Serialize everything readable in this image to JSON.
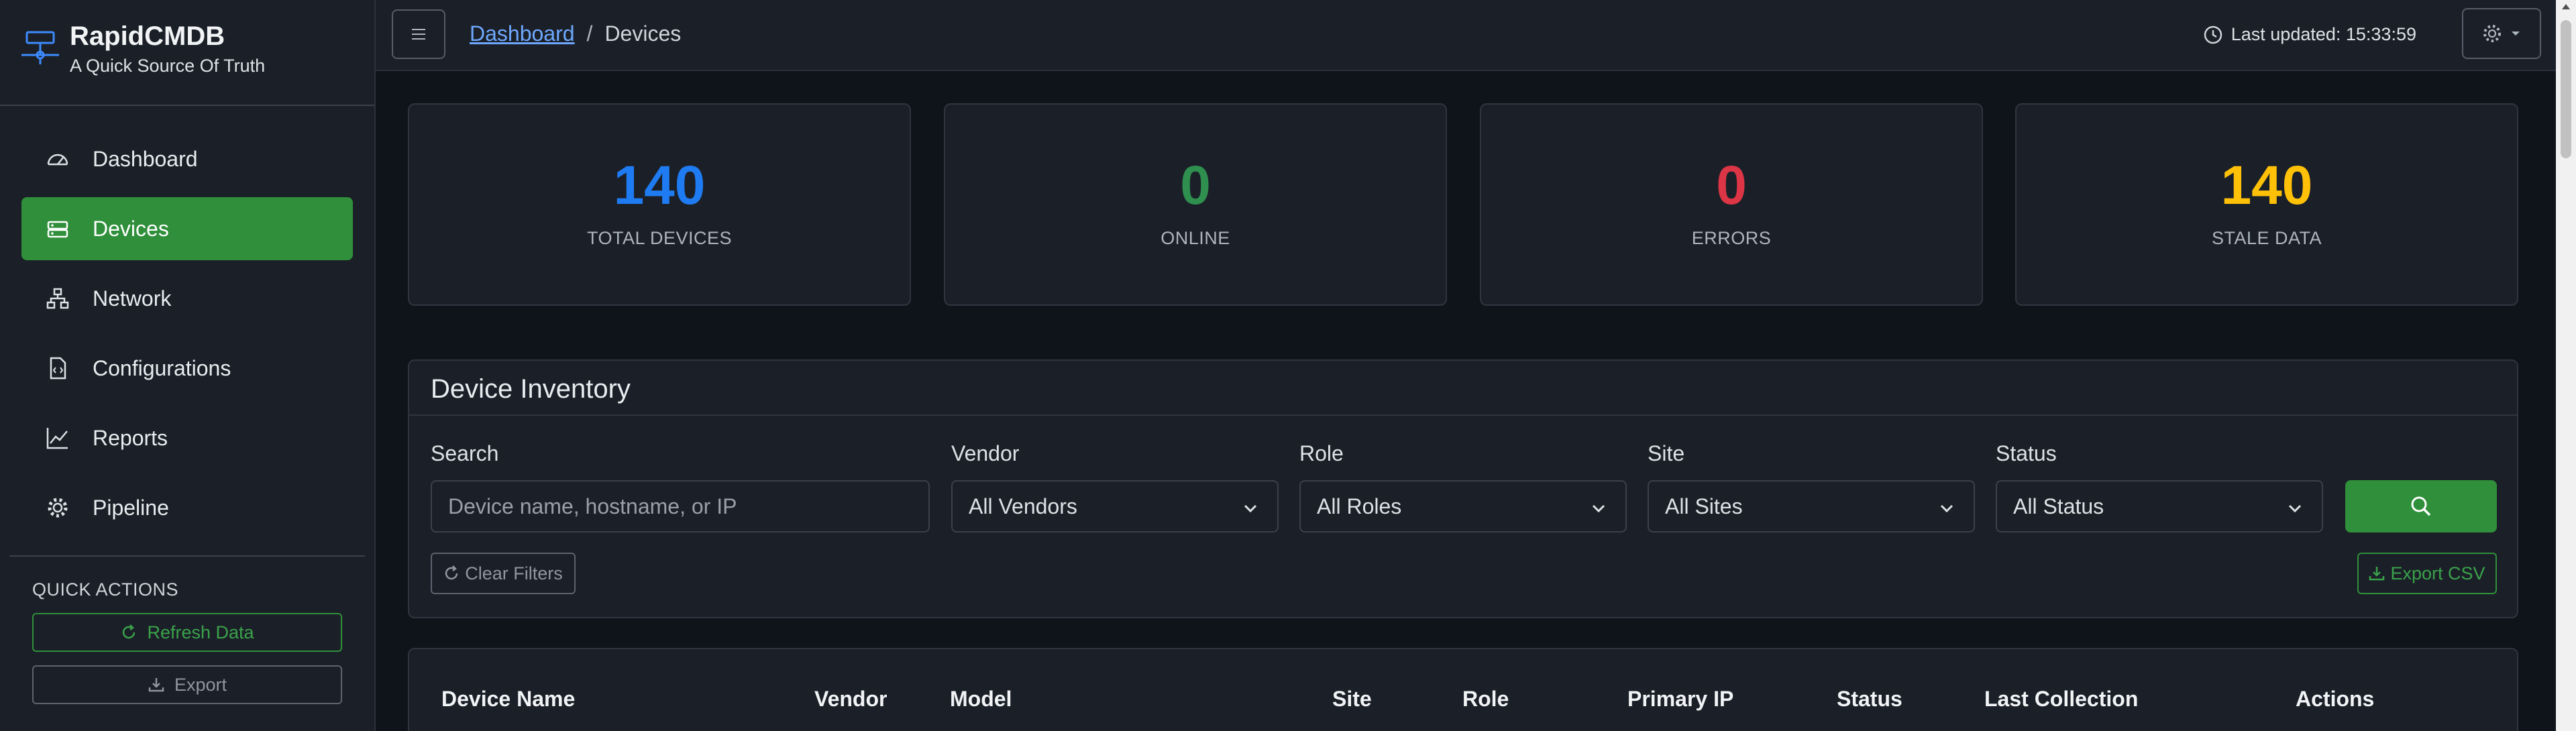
{
  "brand": {
    "title": "RapidCMDB",
    "subtitle": "A Quick Source Of Truth"
  },
  "sidebar": {
    "items": [
      {
        "label": "Dashboard",
        "icon": "speedometer-icon",
        "active": false
      },
      {
        "label": "Devices",
        "icon": "hdd-rack-icon",
        "active": true
      },
      {
        "label": "Network",
        "icon": "diagram-icon",
        "active": false
      },
      {
        "label": "Configurations",
        "icon": "file-code-icon",
        "active": false
      },
      {
        "label": "Reports",
        "icon": "graph-up-icon",
        "active": false
      },
      {
        "label": "Pipeline",
        "icon": "gear-icon",
        "active": false
      }
    ],
    "quick_actions": {
      "title": "QUICK ACTIONS",
      "refresh": "Refresh Data",
      "export": "Export"
    }
  },
  "header": {
    "breadcrumb": {
      "home": "Dashboard",
      "separator": "/",
      "current": "Devices"
    },
    "last_updated": "Last updated: 15:33:59"
  },
  "stats": [
    {
      "value": "140",
      "label": "TOTAL DEVICES",
      "color": "#1f7bf2"
    },
    {
      "value": "0",
      "label": "ONLINE",
      "color": "#2f8f4e"
    },
    {
      "value": "0",
      "label": "ERRORS",
      "color": "#dc3545"
    },
    {
      "value": "140",
      "label": "STALE DATA",
      "color": "#ffc107"
    }
  ],
  "inventory": {
    "title": "Device Inventory",
    "search": {
      "label": "Search",
      "placeholder": "Device name, hostname, or IP"
    },
    "vendor": {
      "label": "Vendor",
      "value": "All Vendors"
    },
    "role": {
      "label": "Role",
      "value": "All Roles"
    },
    "site": {
      "label": "Site",
      "value": "All Sites"
    },
    "status": {
      "label": "Status",
      "value": "All Status"
    },
    "clear": "Clear Filters",
    "export_csv": "Export CSV"
  },
  "table": {
    "columns": [
      "Device Name",
      "Vendor",
      "Model",
      "Site",
      "Role",
      "Primary IP",
      "Status",
      "Last Collection",
      "Actions"
    ]
  },
  "colors": {
    "accent": "#2f8f3a",
    "link": "#6ea8fe"
  }
}
